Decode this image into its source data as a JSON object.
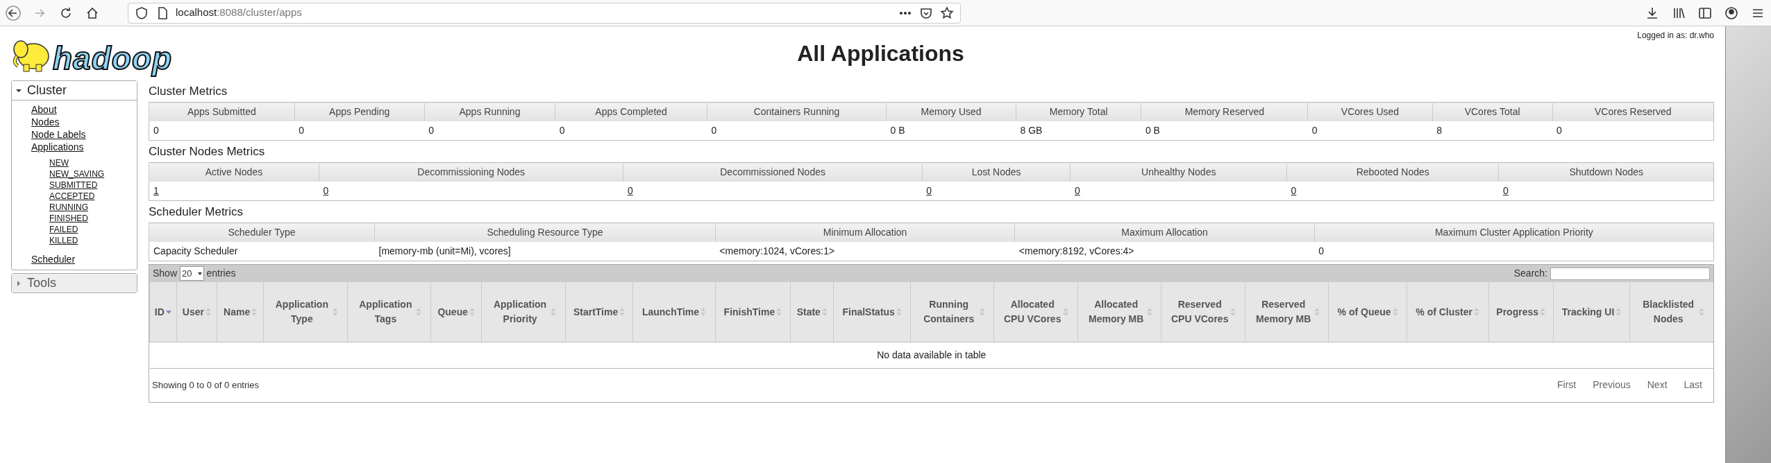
{
  "browser": {
    "url": "**localhost**:8088/cluster/apps"
  },
  "header": {
    "logo_text": "hadoop",
    "title": "All Applications",
    "login": "Logged in as: dr.who"
  },
  "sidebar": [
    {
      "label": "Cluster",
      "expanded": true,
      "items": [
        {
          "label": "About"
        },
        {
          "label": "Nodes"
        },
        {
          "label": "Node Labels"
        },
        {
          "label": "Applications",
          "children": [
            {
              "label": "NEW"
            },
            {
              "label": "NEW_SAVING"
            },
            {
              "label": "SUBMITTED"
            },
            {
              "label": "ACCEPTED"
            },
            {
              "label": "RUNNING"
            },
            {
              "label": "FINISHED"
            },
            {
              "label": "FAILED"
            },
            {
              "label": "KILLED"
            }
          ]
        },
        {
          "label": "Scheduler"
        }
      ]
    },
    {
      "label": "Tools",
      "expanded": false
    }
  ],
  "metrics": [
    {
      "title": "Cluster Metrics",
      "links": false,
      "columns": [
        "Apps Submitted",
        "Apps Pending",
        "Apps Running",
        "Apps Completed",
        "Containers Running",
        "Memory Used",
        "Memory Total",
        "Memory Reserved",
        "VCores Used",
        "VCores Total",
        "VCores Reserved"
      ],
      "values": [
        "0",
        "0",
        "0",
        "0",
        "0",
        "0 B",
        "8 GB",
        "0 B",
        "0",
        "8",
        "0"
      ]
    },
    {
      "title": "Cluster Nodes Metrics",
      "links": true,
      "columns": [
        "Active Nodes",
        "Decommissioning Nodes",
        "Decommissioned Nodes",
        "Lost Nodes",
        "Unhealthy Nodes",
        "Rebooted Nodes",
        "Shutdown Nodes"
      ],
      "values": [
        "1",
        "0",
        "0",
        "0",
        "0",
        "0",
        "0"
      ]
    },
    {
      "title": "Scheduler Metrics",
      "links": false,
      "columns": [
        "Scheduler Type",
        "Scheduling Resource Type",
        "Minimum Allocation",
        "Maximum Allocation",
        "Maximum Cluster Application Priority"
      ],
      "values": [
        "Capacity Scheduler",
        "[memory-mb (unit=Mi), vcores]",
        "<memory:1024, vCores:1>",
        "<memory:8192, vCores:4>",
        "0"
      ]
    }
  ],
  "apps": {
    "show": "Show",
    "length": "20",
    "entries": "entries",
    "search": "Search:",
    "columns": [
      {
        "label": "ID",
        "sorted": true
      },
      {
        "label": "User",
        "sorted": false
      },
      {
        "label": "Name",
        "sorted": false
      },
      {
        "label": "Application Type",
        "sorted": false
      },
      {
        "label": "Application Tags",
        "sorted": false
      },
      {
        "label": "Queue",
        "sorted": false
      },
      {
        "label": "Application Priority",
        "sorted": false
      },
      {
        "label": "StartTime",
        "sorted": false
      },
      {
        "label": "LaunchTime",
        "sorted": false
      },
      {
        "label": "FinishTime",
        "sorted": false
      },
      {
        "label": "State",
        "sorted": false
      },
      {
        "label": "FinalStatus",
        "sorted": false
      },
      {
        "label": "Running Containers",
        "sorted": false
      },
      {
        "label": "Allocated CPU VCores",
        "sorted": false
      },
      {
        "label": "Allocated Memory MB",
        "sorted": false
      },
      {
        "label": "Reserved CPU VCores",
        "sorted": false
      },
      {
        "label": "Reserved Memory MB",
        "sorted": false
      },
      {
        "label": "% of Queue",
        "sorted": false
      },
      {
        "label": "% of Cluster",
        "sorted": false
      },
      {
        "label": "Progress",
        "sorted": false
      },
      {
        "label": "Tracking UI",
        "sorted": false
      },
      {
        "label": "Blacklisted Nodes",
        "sorted": false
      }
    ],
    "empty": "No data available in table",
    "info": "Showing 0 to 0 of 0 entries",
    "pages": [
      "First",
      "Previous",
      "Next",
      "Last"
    ]
  }
}
